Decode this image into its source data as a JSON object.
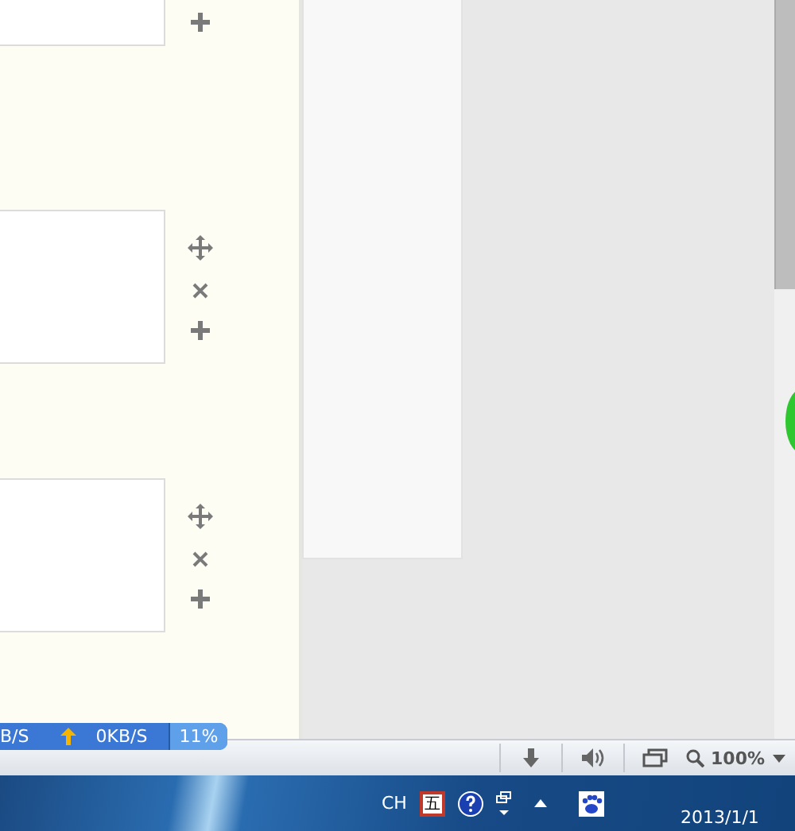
{
  "cards": [
    {
      "actions": [
        {
          "kind": "add"
        }
      ]
    },
    {
      "actions": [
        {
          "kind": "move"
        },
        {
          "kind": "delete"
        },
        {
          "kind": "add"
        }
      ]
    },
    {
      "actions": [
        {
          "kind": "move"
        },
        {
          "kind": "delete"
        },
        {
          "kind": "add"
        }
      ]
    }
  ],
  "speed_meter": {
    "download": "B/S",
    "upload": "0KB/S",
    "usage": "11%"
  },
  "status_bar": {
    "zoom": "100%"
  },
  "taskbar": {
    "language": "CH",
    "ime": "五",
    "date": "2013/1/1"
  }
}
